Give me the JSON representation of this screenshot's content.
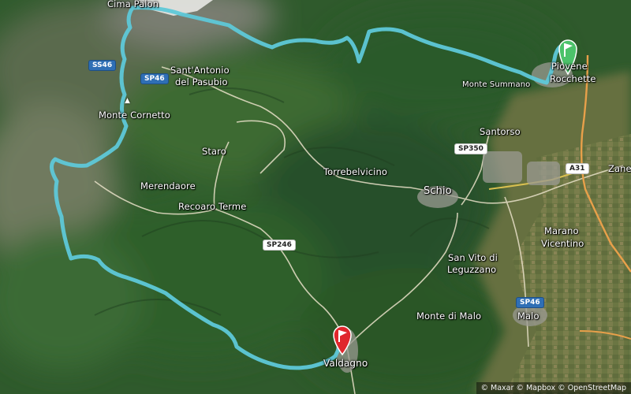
{
  "map": {
    "route_color": "#5ec8d8",
    "start_marker_color": "#4cc26a",
    "end_marker_color": "#e0262c",
    "road_color_major": "#e8a04a",
    "road_color_minor": "#e8e0c8"
  },
  "places": {
    "cima_palon": "Cima Palon",
    "sant_antonio": "Sant'Antonio",
    "del_pasubio": "del Pasubio",
    "monte_cornetto": "Monte Cornetto",
    "staro": "Staro",
    "merendaore": "Merendaore",
    "recoaro_terme": "Recoaro Terme",
    "torrebelvicino": "Torrebelvicino",
    "schio": "Schio",
    "santorso": "Santorso",
    "piovene": "Piovene",
    "rocchette": "Rocchette",
    "monte_summano": "Monte Summano",
    "san_vito": "San Vito di",
    "leguzzano": "Leguzzano",
    "monte_di_malo": "Monte di Malo",
    "malo": "Malo",
    "marano": "Marano",
    "vicentino": "Vicentino",
    "zane": "Zane",
    "valdagno": "Valdagno"
  },
  "roads": {
    "ss46": "SS46",
    "sp46_top": "SP46",
    "sp350": "SP350",
    "a31": "A31",
    "sp246": "SP246",
    "sp46_bottom": "SP46"
  },
  "attribution": "© Maxar © Mapbox © OpenStreetMap"
}
